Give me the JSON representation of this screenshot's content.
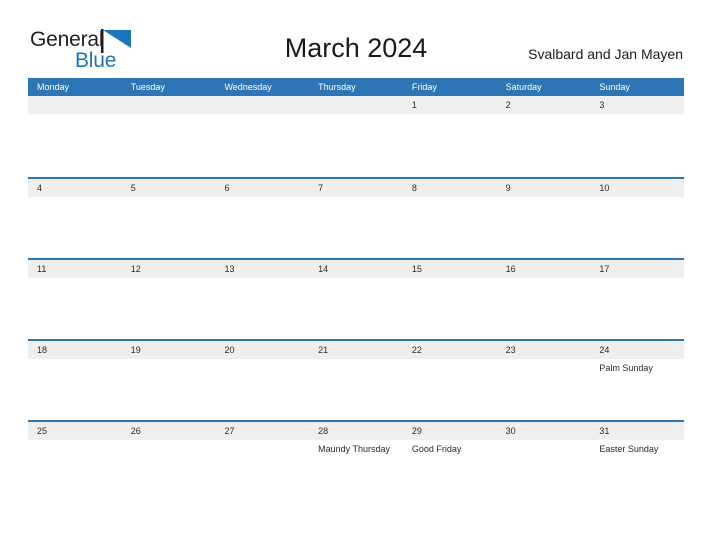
{
  "brand": {
    "name_part1": "General",
    "name_part2": "Blue",
    "flag_icon": "blue-triangle-flag-icon",
    "color_dark": "#231f20",
    "color_blue": "#1b76bc"
  },
  "header": {
    "title": "March 2024",
    "region": "Svalbard and Jan Mayen"
  },
  "calendar": {
    "accent_color": "#2e75b6",
    "date_band_color": "#efefef",
    "weekdays": [
      "Monday",
      "Tuesday",
      "Wednesday",
      "Thursday",
      "Friday",
      "Saturday",
      "Sunday"
    ],
    "weeks": [
      [
        {
          "date": "",
          "event": ""
        },
        {
          "date": "",
          "event": ""
        },
        {
          "date": "",
          "event": ""
        },
        {
          "date": "",
          "event": ""
        },
        {
          "date": "1",
          "event": ""
        },
        {
          "date": "2",
          "event": ""
        },
        {
          "date": "3",
          "event": ""
        }
      ],
      [
        {
          "date": "4",
          "event": ""
        },
        {
          "date": "5",
          "event": ""
        },
        {
          "date": "6",
          "event": ""
        },
        {
          "date": "7",
          "event": ""
        },
        {
          "date": "8",
          "event": ""
        },
        {
          "date": "9",
          "event": ""
        },
        {
          "date": "10",
          "event": ""
        }
      ],
      [
        {
          "date": "11",
          "event": ""
        },
        {
          "date": "12",
          "event": ""
        },
        {
          "date": "13",
          "event": ""
        },
        {
          "date": "14",
          "event": ""
        },
        {
          "date": "15",
          "event": ""
        },
        {
          "date": "16",
          "event": ""
        },
        {
          "date": "17",
          "event": ""
        }
      ],
      [
        {
          "date": "18",
          "event": ""
        },
        {
          "date": "19",
          "event": ""
        },
        {
          "date": "20",
          "event": ""
        },
        {
          "date": "21",
          "event": ""
        },
        {
          "date": "22",
          "event": ""
        },
        {
          "date": "23",
          "event": ""
        },
        {
          "date": "24",
          "event": "Palm Sunday"
        }
      ],
      [
        {
          "date": "25",
          "event": ""
        },
        {
          "date": "26",
          "event": ""
        },
        {
          "date": "27",
          "event": ""
        },
        {
          "date": "28",
          "event": "Maundy Thursday"
        },
        {
          "date": "29",
          "event": "Good Friday"
        },
        {
          "date": "30",
          "event": ""
        },
        {
          "date": "31",
          "event": "Easter Sunday"
        }
      ]
    ]
  }
}
